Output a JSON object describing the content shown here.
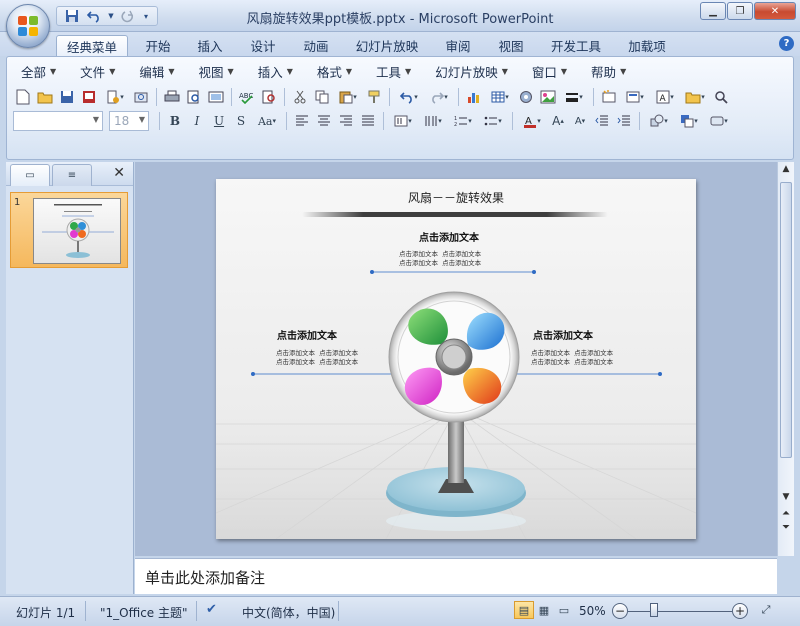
{
  "window": {
    "title": "风扇旋转效果ppt模板.pptx - Microsoft PowerPoint",
    "minimize_icon": "minimize-icon",
    "restore_icon": "restore-icon",
    "close_icon": "close-icon"
  },
  "ribbon_tabs": [
    "经典菜单",
    "开始",
    "插入",
    "设计",
    "动画",
    "幻灯片放映",
    "审阅",
    "视图",
    "开发工具",
    "加载项"
  ],
  "menus": [
    "全部",
    "文件",
    "编辑",
    "视图",
    "插入",
    "格式",
    "工具",
    "幻灯片放映",
    "窗口",
    "帮助"
  ],
  "font_size": "18",
  "slides_panel": {
    "slide_number": "1"
  },
  "slide": {
    "title": "风扇－－旋转效果",
    "top": {
      "heading": "点击添加文本",
      "lines": "点击添加文本  点击添加文本\n点击添加文本  点击添加文本"
    },
    "left": {
      "heading": "点击添加文本",
      "lines": "点击添加文本  点击添加文本\n点击添加文本  点击添加文本"
    },
    "right": {
      "heading": "点击添加文本",
      "lines": "点击添加文本  点击添加文本\n点击添加文本  点击添加文本"
    }
  },
  "notes": {
    "placeholder": "单击此处添加备注"
  },
  "status": {
    "slide_info": "幻灯片 1/1",
    "theme": "\"1_Office 主题\"",
    "language": "中文(简体，中国)",
    "zoom": "50%"
  },
  "colors": {
    "accent_orange": "#f5b85d",
    "ribbon_blue": "#c8d7ed",
    "pinwheel_blue": "#2f8fd8",
    "pinwheel_green": "#2fa84a",
    "pinwheel_magenta": "#e23ad0",
    "pinwheel_orange": "#f06a1e"
  }
}
